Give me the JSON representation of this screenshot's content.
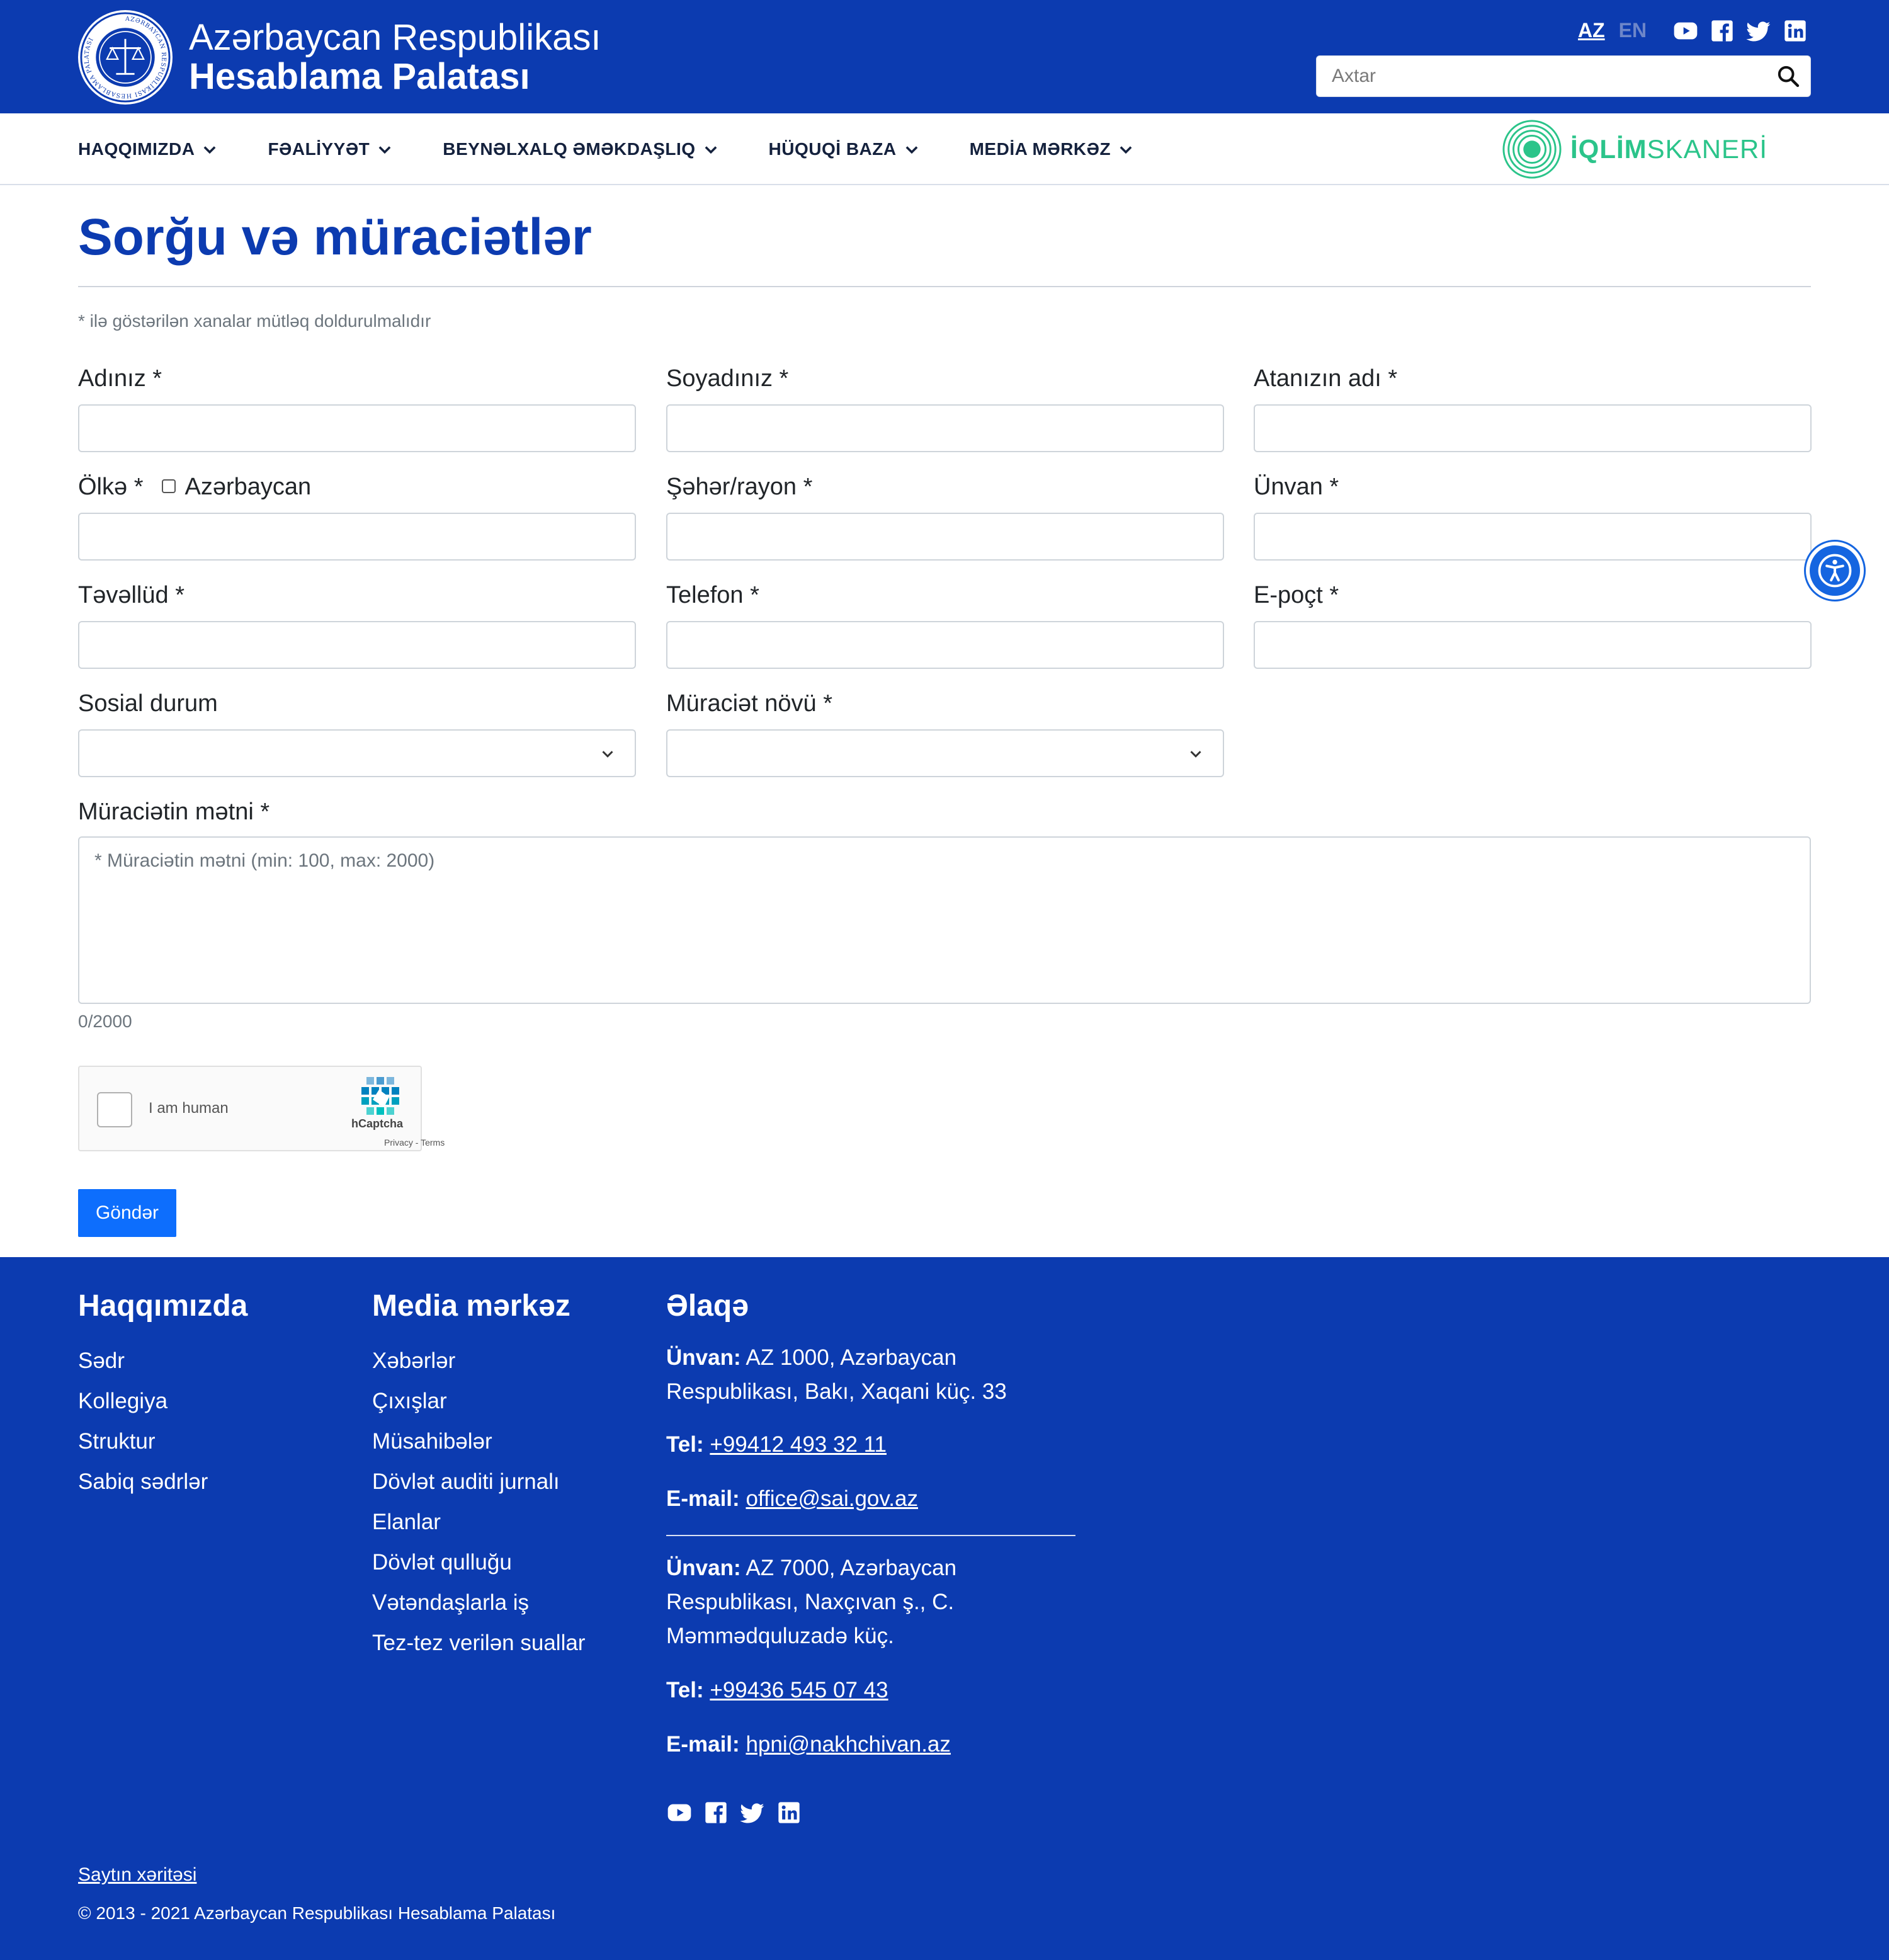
{
  "header": {
    "org_line1": "Azərbaycan Respublikası",
    "org_line2": "Hesablama Palatası",
    "emblem_text": "AZƏRBAYCAN RESPUBLİKASI HESABLAMA PALATASI",
    "lang_active": "AZ",
    "lang_inactive": "EN",
    "search_placeholder": "Axtar",
    "socials": [
      "youtube-icon",
      "facebook-icon",
      "twitter-icon",
      "linkedin-icon"
    ],
    "brand_color": "#0c3bb0"
  },
  "nav": {
    "items": [
      {
        "label": "HAQQIMIZDA"
      },
      {
        "label": "FƏALİYYƏT"
      },
      {
        "label": "BEYNƏLXALQ ƏMƏKDAŞLIQ"
      },
      {
        "label": "HÜQUQİ BAZA"
      },
      {
        "label": "MEDİA MƏRKƏZ"
      }
    ],
    "iqlim_bold": "İQLİM",
    "iqlim_light": "SKANERİ",
    "iqlim_color": "#2bc48a"
  },
  "main": {
    "title": "Sorğu və müraciətlər",
    "required_note": "* ilə göstərilən xanalar mütləq doldurulmalıdır",
    "fields": {
      "first_name": "Adınız *",
      "last_name": "Soyadınız *",
      "father_name": "Atanızın adı *",
      "country": "Ölkə *",
      "country_checkbox": "Azərbaycan",
      "city": "Şəhər/rayon *",
      "address": "Ünvan *",
      "birth_date": "Təvəllüd *",
      "phone": "Telefon *",
      "email": "E-poçt *",
      "social_status": "Sosial durum",
      "appeal_type": "Müraciət növü *",
      "appeal_text": "Müraciətin mətni *"
    },
    "textarea_placeholder": "* Müraciətin mətni (min: 100, max: 2000)",
    "counter": "0/2000",
    "captcha": {
      "label": "I am human",
      "brand": "hCaptcha",
      "links": "Privacy - Terms"
    },
    "submit_label": "Göndər",
    "button_color": "#0d6efd"
  },
  "footer": {
    "about": {
      "heading": "Haqqımızda",
      "links": [
        "Sədr",
        "Kollegiya",
        "Struktur",
        "Sabiq sədrlər"
      ]
    },
    "media": {
      "heading": "Media mərkəz",
      "links": [
        "Xəbərlər",
        "Çıxışlar",
        "Müsahibələr",
        "Dövlət auditi jurnalı",
        "Elanlar",
        "Dövlət qulluğu",
        "Vətəndaşlarla iş",
        "Tez-tez verilən suallar"
      ]
    },
    "contact": {
      "heading": "Əlaqə",
      "address_label": "Ünvan:",
      "address1_line1": "AZ 1000, Azərbaycan",
      "address1_line2": "Respublikası, Bakı, Xaqani küç. 33",
      "tel_label": "Tel:",
      "tel1": "+99412 493 32 11",
      "email_label": "E-mail:",
      "email1": "office@sai.gov.az",
      "address2_line1": "AZ 7000, Azərbaycan",
      "address2_line2": "Respublikası, Naxçıvan ş., C.",
      "address2_line3": "Məmmədquluzadə küç.",
      "tel2": "+99436 545 07 43",
      "email2": "hpni@nakhchivan.az"
    },
    "sitemap": "Saytın xəritəsi",
    "copyright": "© 2013 - 2021 Azərbaycan Respublikası Hesablama Palatası"
  }
}
